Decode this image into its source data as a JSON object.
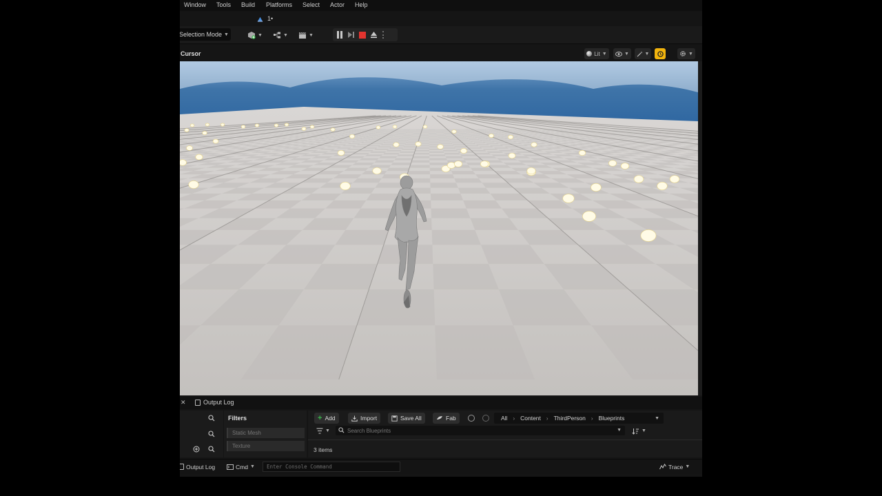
{
  "menu": {
    "items": [
      "Window",
      "Tools",
      "Build",
      "Platforms",
      "Select",
      "Actor",
      "Help"
    ]
  },
  "level_tab": {
    "label": "1•"
  },
  "toolbar": {
    "selection_mode": "Selection Mode"
  },
  "viewport": {
    "cursor_label": "Cursor",
    "lit_label": "Lit"
  },
  "panel": {
    "output_log_tab": "Output Log"
  },
  "filters": {
    "title": "Filters",
    "chips": [
      "Static Mesh",
      "Texture"
    ]
  },
  "content_browser": {
    "add": "Add",
    "import": "Import",
    "save_all": "Save All",
    "fab": "Fab",
    "breadcrumb": [
      "All",
      "Content",
      "ThirdPerson",
      "Blueprints"
    ],
    "search_placeholder": "Search Blueprints",
    "items_count": "3 items"
  },
  "statusbar": {
    "output_log": "Output Log",
    "cmd": "Cmd",
    "console_placeholder": "Enter Console Command",
    "trace": "Trace"
  },
  "colors": {
    "stop": "#e3342f",
    "accent_active": "#f2b40d",
    "add_icon": "#39b54a"
  }
}
